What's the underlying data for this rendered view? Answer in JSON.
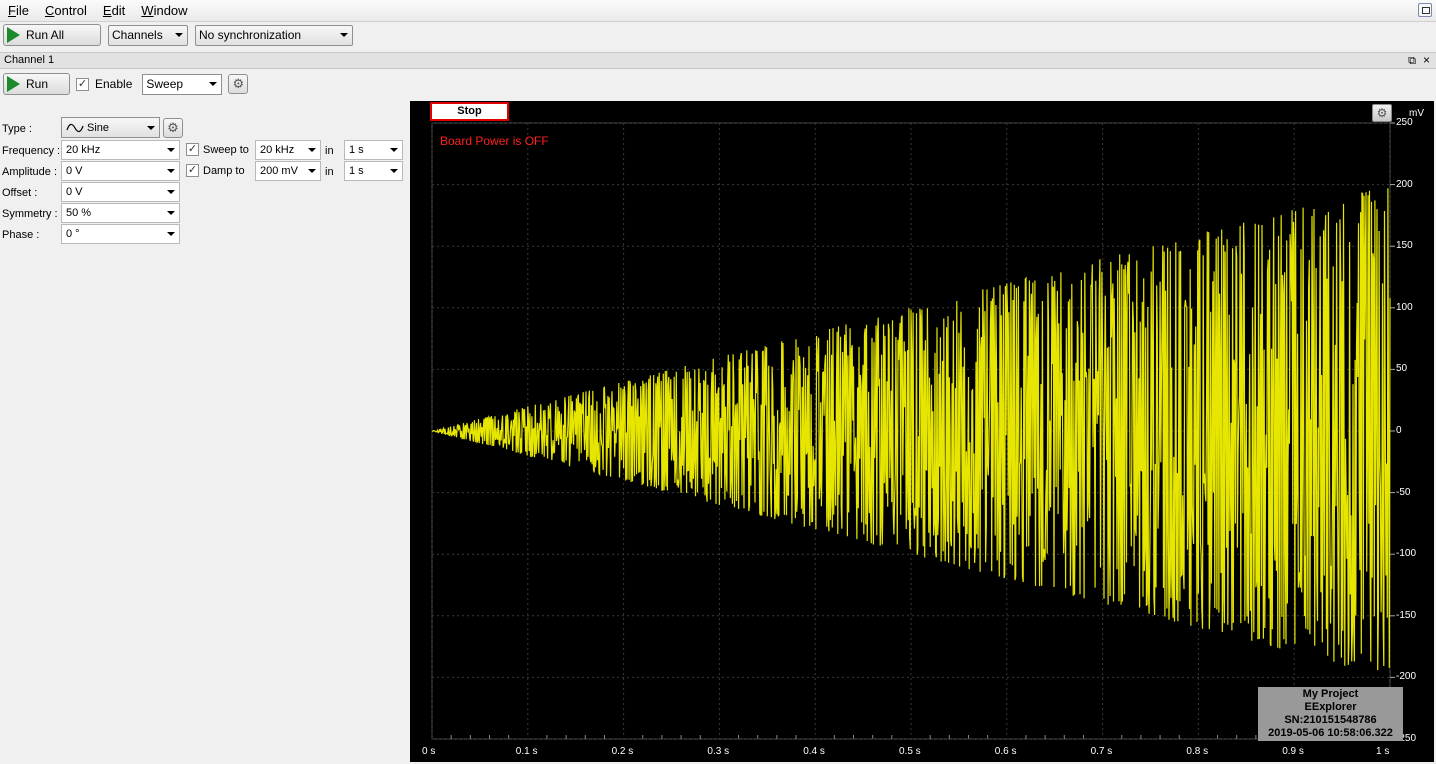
{
  "menu": [
    "File",
    "Control",
    "Edit",
    "Window"
  ],
  "toolbar": {
    "run_all": "Run All",
    "channels": "Channels",
    "sync": "No synchronization"
  },
  "channel": {
    "title": "Channel 1",
    "run": "Run",
    "enable": "Enable",
    "mode": "Sweep"
  },
  "form": {
    "type_label": "Type :",
    "type_value": "Sine",
    "frequency_label": "Frequency :",
    "frequency_value": "20 kHz",
    "amplitude_label": "Amplitude :",
    "amplitude_value": "0 V",
    "offset_label": "Offset :",
    "offset_value": "0 V",
    "symmetry_label": "Symmetry :",
    "symmetry_value": "50 %",
    "phase_label": "Phase :",
    "phase_value": "0 °",
    "sweep_label": "Sweep to",
    "sweep_value": "20 kHz",
    "sweep_in": "in",
    "sweep_time": "1 s",
    "damp_label": "Damp to",
    "damp_value": "200 mV",
    "damp_in": "in",
    "damp_time": "1 s"
  },
  "scope": {
    "stop": "Stop",
    "message": "Board Power is OFF",
    "unit": "mV",
    "info": {
      "project": "My Project",
      "device": "EExplorer",
      "serial": "SN:210151548786",
      "timestamp": "2019-05-06 10:58:06.322"
    },
    "colors": {
      "trace": "#e6e600",
      "grid": "#3a3a3a",
      "warning": "#ff2020"
    }
  },
  "chart_data": {
    "type": "line",
    "xlabel": "",
    "ylabel": "mV",
    "xlim": [
      0,
      1
    ],
    "ylim": [
      -250,
      250
    ],
    "x_ticks": [
      "0 s",
      "0.1 s",
      "0.2 s",
      "0.3 s",
      "0.4 s",
      "0.5 s",
      "0.6 s",
      "0.7 s",
      "0.8 s",
      "0.9 s",
      "1 s"
    ],
    "y_ticks": [
      "250",
      "200",
      "150",
      "100",
      "50",
      "0",
      "-50",
      "-100",
      "-150",
      "-200",
      "-250"
    ],
    "series": [
      {
        "color": "#e6e600",
        "description_values": {
          "waveform": "sine",
          "amplitude_start_mV": 0,
          "amplitude_end_mV": 200,
          "duration_s": 1
        }
      }
    ],
    "grid": true
  }
}
